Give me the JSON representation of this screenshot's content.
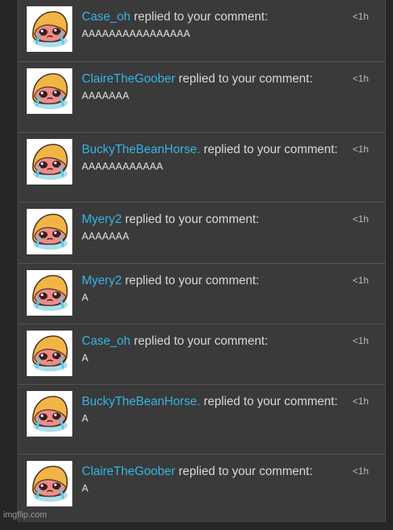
{
  "notifications": [
    {
      "user": "Case_oh",
      "action": " replied to your comment:",
      "message": "AAAAAAAAAAAAAAAA",
      "time": "<1h"
    },
    {
      "user": "ClaireTheGoober",
      "action": " replied to your comment:",
      "message": "AAAAAAA",
      "time": "<1h"
    },
    {
      "user": "BuckyTheBeanHorse.",
      "action": " replied to your comment:",
      "message": "AAAAAAAAAAAA",
      "time": "<1h"
    },
    {
      "user": "Myery2",
      "action": " replied to your comment:",
      "message": "AAAAAAA",
      "time": "<1h"
    },
    {
      "user": "Myery2",
      "action": " replied to your comment:",
      "message": "A",
      "time": "<1h"
    },
    {
      "user": "Case_oh",
      "action": " replied to your comment:",
      "message": "A",
      "time": "<1h"
    },
    {
      "user": "BuckyTheBeanHorse.",
      "action": " replied to your comment:",
      "message": "A",
      "time": "<1h"
    },
    {
      "user": "ClaireTheGoober",
      "action": " replied to your comment:",
      "message": "A",
      "time": "<1h"
    }
  ],
  "watermark": "imgflip.com",
  "colors": {
    "username": "#34b5e8",
    "panel": "#3a3a3a",
    "page": "#262628"
  },
  "avatar_icon": "crying-blob-avatar-icon"
}
